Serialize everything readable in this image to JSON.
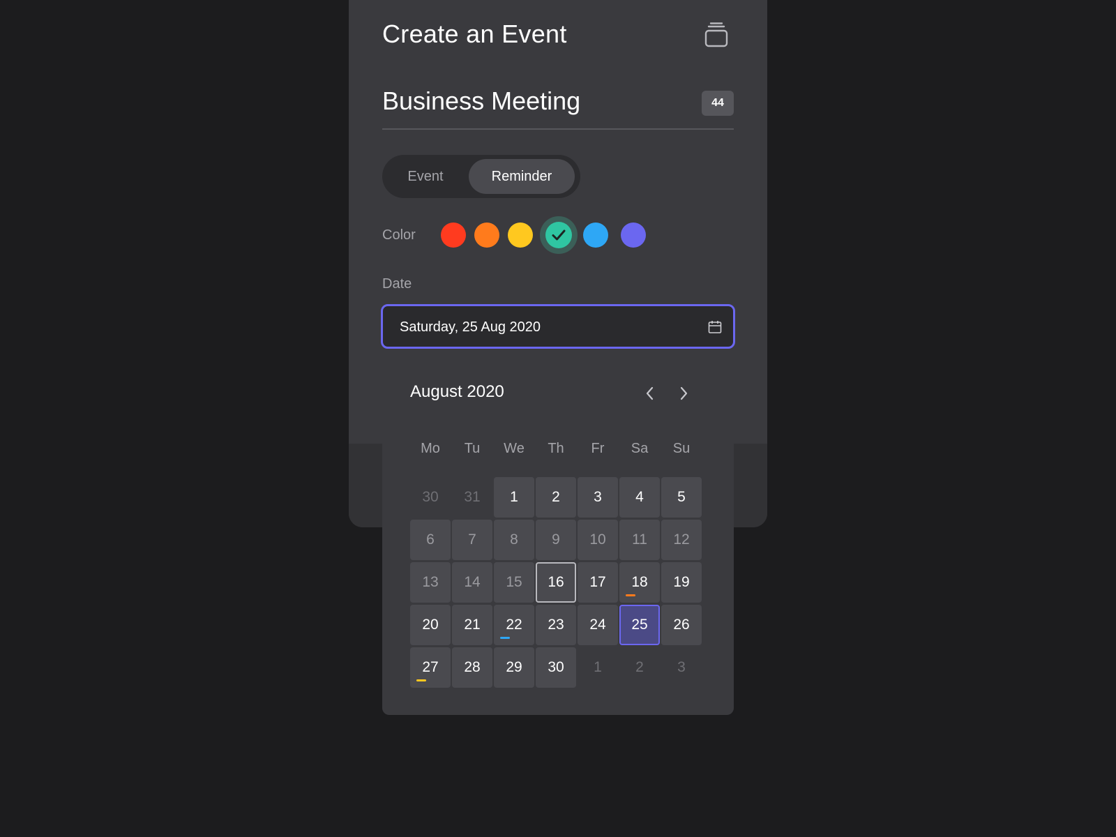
{
  "header": {
    "title": "Create an Event",
    "stack_icon": "stack-icon"
  },
  "event": {
    "name": "Business Meeting",
    "char_count": "44"
  },
  "type_toggle": {
    "options": [
      "Event",
      "Reminder"
    ],
    "selected": "Reminder"
  },
  "color": {
    "label": "Color",
    "swatches": [
      {
        "name": "red",
        "hex": "#ff3b1f"
      },
      {
        "name": "orange",
        "hex": "#ff7b1c"
      },
      {
        "name": "yellow",
        "hex": "#ffc81f"
      },
      {
        "name": "teal",
        "hex": "#2fc6a2"
      },
      {
        "name": "blue",
        "hex": "#2ea7f5"
      },
      {
        "name": "purple",
        "hex": "#6b67f0"
      }
    ],
    "selected": "teal"
  },
  "date": {
    "label": "Date",
    "value": "Saturday, 25 Aug 2020",
    "icon": "calendar-icon"
  },
  "calendar": {
    "month_title": "August 2020",
    "weekdays": [
      "Mo",
      "Tu",
      "We",
      "Th",
      "Fr",
      "Sa",
      "Su"
    ],
    "today": "16",
    "selected": "25",
    "weeks": [
      [
        {
          "d": "30",
          "state": "outside"
        },
        {
          "d": "31",
          "state": "outside"
        },
        {
          "d": "1",
          "state": "in"
        },
        {
          "d": "2",
          "state": "in"
        },
        {
          "d": "3",
          "state": "in"
        },
        {
          "d": "4",
          "state": "in"
        },
        {
          "d": "5",
          "state": "in"
        }
      ],
      [
        {
          "d": "6",
          "state": "past"
        },
        {
          "d": "7",
          "state": "past"
        },
        {
          "d": "8",
          "state": "past"
        },
        {
          "d": "9",
          "state": "past"
        },
        {
          "d": "10",
          "state": "past"
        },
        {
          "d": "11",
          "state": "past"
        },
        {
          "d": "12",
          "state": "past"
        }
      ],
      [
        {
          "d": "13",
          "state": "past"
        },
        {
          "d": "14",
          "state": "past"
        },
        {
          "d": "15",
          "state": "past"
        },
        {
          "d": "16",
          "state": "today"
        },
        {
          "d": "17",
          "state": "in"
        },
        {
          "d": "18",
          "state": "in",
          "marker": "#ff7b1c"
        },
        {
          "d": "19",
          "state": "in"
        }
      ],
      [
        {
          "d": "20",
          "state": "in"
        },
        {
          "d": "21",
          "state": "in"
        },
        {
          "d": "22",
          "state": "in",
          "marker": "#2ea7f5"
        },
        {
          "d": "23",
          "state": "in"
        },
        {
          "d": "24",
          "state": "in"
        },
        {
          "d": "25",
          "state": "selected"
        },
        {
          "d": "26",
          "state": "in"
        }
      ],
      [
        {
          "d": "27",
          "state": "in",
          "marker": "#ffc81f"
        },
        {
          "d": "28",
          "state": "in"
        },
        {
          "d": "29",
          "state": "in"
        },
        {
          "d": "30",
          "state": "in"
        },
        {
          "d": "1",
          "state": "outside"
        },
        {
          "d": "2",
          "state": "outside"
        },
        {
          "d": "3",
          "state": "outside"
        }
      ]
    ]
  }
}
